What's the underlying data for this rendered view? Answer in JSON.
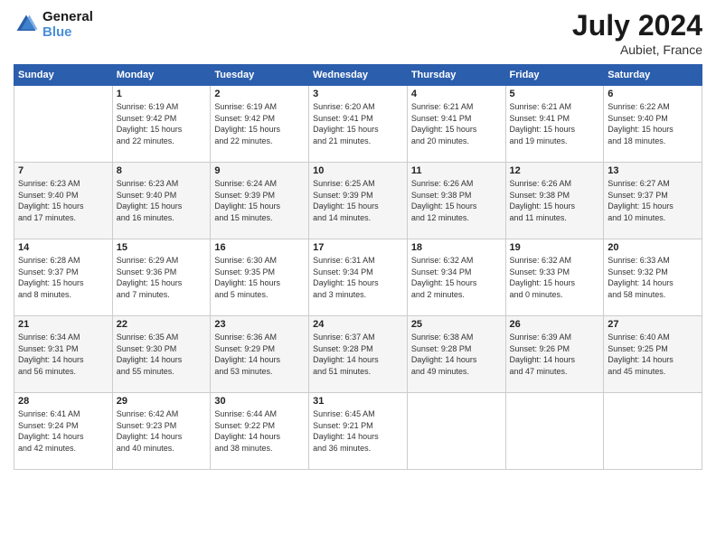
{
  "header": {
    "logo_line1": "General",
    "logo_line2": "Blue",
    "month_year": "July 2024",
    "location": "Aubiet, France"
  },
  "days_of_week": [
    "Sunday",
    "Monday",
    "Tuesday",
    "Wednesday",
    "Thursday",
    "Friday",
    "Saturday"
  ],
  "weeks": [
    [
      {
        "day": "",
        "info": ""
      },
      {
        "day": "1",
        "info": "Sunrise: 6:19 AM\nSunset: 9:42 PM\nDaylight: 15 hours\nand 22 minutes."
      },
      {
        "day": "2",
        "info": "Sunrise: 6:19 AM\nSunset: 9:42 PM\nDaylight: 15 hours\nand 22 minutes."
      },
      {
        "day": "3",
        "info": "Sunrise: 6:20 AM\nSunset: 9:41 PM\nDaylight: 15 hours\nand 21 minutes."
      },
      {
        "day": "4",
        "info": "Sunrise: 6:21 AM\nSunset: 9:41 PM\nDaylight: 15 hours\nand 20 minutes."
      },
      {
        "day": "5",
        "info": "Sunrise: 6:21 AM\nSunset: 9:41 PM\nDaylight: 15 hours\nand 19 minutes."
      },
      {
        "day": "6",
        "info": "Sunrise: 6:22 AM\nSunset: 9:40 PM\nDaylight: 15 hours\nand 18 minutes."
      }
    ],
    [
      {
        "day": "7",
        "info": "Sunrise: 6:23 AM\nSunset: 9:40 PM\nDaylight: 15 hours\nand 17 minutes."
      },
      {
        "day": "8",
        "info": "Sunrise: 6:23 AM\nSunset: 9:40 PM\nDaylight: 15 hours\nand 16 minutes."
      },
      {
        "day": "9",
        "info": "Sunrise: 6:24 AM\nSunset: 9:39 PM\nDaylight: 15 hours\nand 15 minutes."
      },
      {
        "day": "10",
        "info": "Sunrise: 6:25 AM\nSunset: 9:39 PM\nDaylight: 15 hours\nand 14 minutes."
      },
      {
        "day": "11",
        "info": "Sunrise: 6:26 AM\nSunset: 9:38 PM\nDaylight: 15 hours\nand 12 minutes."
      },
      {
        "day": "12",
        "info": "Sunrise: 6:26 AM\nSunset: 9:38 PM\nDaylight: 15 hours\nand 11 minutes."
      },
      {
        "day": "13",
        "info": "Sunrise: 6:27 AM\nSunset: 9:37 PM\nDaylight: 15 hours\nand 10 minutes."
      }
    ],
    [
      {
        "day": "14",
        "info": "Sunrise: 6:28 AM\nSunset: 9:37 PM\nDaylight: 15 hours\nand 8 minutes."
      },
      {
        "day": "15",
        "info": "Sunrise: 6:29 AM\nSunset: 9:36 PM\nDaylight: 15 hours\nand 7 minutes."
      },
      {
        "day": "16",
        "info": "Sunrise: 6:30 AM\nSunset: 9:35 PM\nDaylight: 15 hours\nand 5 minutes."
      },
      {
        "day": "17",
        "info": "Sunrise: 6:31 AM\nSunset: 9:34 PM\nDaylight: 15 hours\nand 3 minutes."
      },
      {
        "day": "18",
        "info": "Sunrise: 6:32 AM\nSunset: 9:34 PM\nDaylight: 15 hours\nand 2 minutes."
      },
      {
        "day": "19",
        "info": "Sunrise: 6:32 AM\nSunset: 9:33 PM\nDaylight: 15 hours\nand 0 minutes."
      },
      {
        "day": "20",
        "info": "Sunrise: 6:33 AM\nSunset: 9:32 PM\nDaylight: 14 hours\nand 58 minutes."
      }
    ],
    [
      {
        "day": "21",
        "info": "Sunrise: 6:34 AM\nSunset: 9:31 PM\nDaylight: 14 hours\nand 56 minutes."
      },
      {
        "day": "22",
        "info": "Sunrise: 6:35 AM\nSunset: 9:30 PM\nDaylight: 14 hours\nand 55 minutes."
      },
      {
        "day": "23",
        "info": "Sunrise: 6:36 AM\nSunset: 9:29 PM\nDaylight: 14 hours\nand 53 minutes."
      },
      {
        "day": "24",
        "info": "Sunrise: 6:37 AM\nSunset: 9:28 PM\nDaylight: 14 hours\nand 51 minutes."
      },
      {
        "day": "25",
        "info": "Sunrise: 6:38 AM\nSunset: 9:28 PM\nDaylight: 14 hours\nand 49 minutes."
      },
      {
        "day": "26",
        "info": "Sunrise: 6:39 AM\nSunset: 9:26 PM\nDaylight: 14 hours\nand 47 minutes."
      },
      {
        "day": "27",
        "info": "Sunrise: 6:40 AM\nSunset: 9:25 PM\nDaylight: 14 hours\nand 45 minutes."
      }
    ],
    [
      {
        "day": "28",
        "info": "Sunrise: 6:41 AM\nSunset: 9:24 PM\nDaylight: 14 hours\nand 42 minutes."
      },
      {
        "day": "29",
        "info": "Sunrise: 6:42 AM\nSunset: 9:23 PM\nDaylight: 14 hours\nand 40 minutes."
      },
      {
        "day": "30",
        "info": "Sunrise: 6:44 AM\nSunset: 9:22 PM\nDaylight: 14 hours\nand 38 minutes."
      },
      {
        "day": "31",
        "info": "Sunrise: 6:45 AM\nSunset: 9:21 PM\nDaylight: 14 hours\nand 36 minutes."
      },
      {
        "day": "",
        "info": ""
      },
      {
        "day": "",
        "info": ""
      },
      {
        "day": "",
        "info": ""
      }
    ]
  ]
}
